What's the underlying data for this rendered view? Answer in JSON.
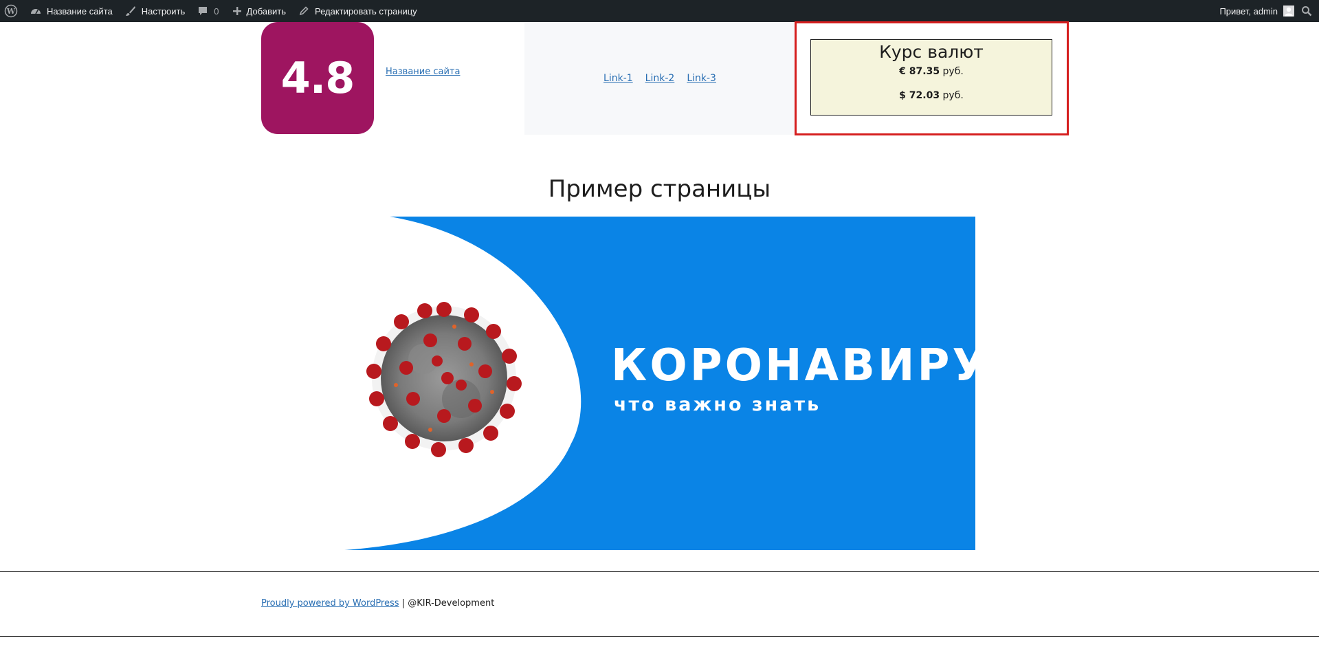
{
  "admin_bar": {
    "wp_logo": "wordpress-logo-icon",
    "site_name": "Название сайта",
    "customize": "Настроить",
    "comments_count": "0",
    "add_new": "Добавить",
    "edit_page": "Редактировать страницу",
    "greeting": "Привет, admin"
  },
  "header": {
    "logo_text": "4.8",
    "site_title": "Название сайта",
    "nav_links": [
      "Link-1",
      "Link-2",
      "Link-3"
    ]
  },
  "currency_widget": {
    "title": "Курс валют",
    "rates": [
      {
        "symbol": "€",
        "value": "87.35",
        "unit": "руб."
      },
      {
        "symbol": "$",
        "value": "72.03",
        "unit": "руб."
      }
    ]
  },
  "main": {
    "page_title": "Пример страницы",
    "banner_title": "КОРОНАВИРУС",
    "banner_subtitle": "что важно знать"
  },
  "footer": {
    "powered_by": "Proudly powered by WordPress",
    "separator": "|",
    "credit": "@KIR-Development"
  },
  "colors": {
    "admin_bar_bg": "#1d2327",
    "logo_bg": "#9e1560",
    "currency_border": "#d51e1e",
    "currency_bg": "#f5f4dc",
    "banner_blue": "#0a84e6",
    "link": "#2a6fb3"
  }
}
